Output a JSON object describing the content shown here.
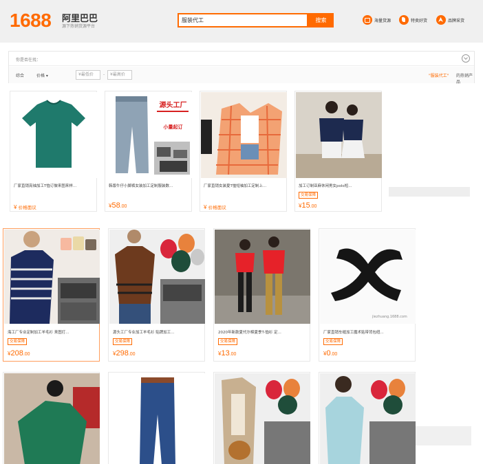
{
  "header": {
    "logo_number": "1688",
    "logo_name": "阿里巴巴",
    "logo_tagline": "源下热销货源平台",
    "search_value": "服装代工",
    "search_button": "搜索",
    "links": [
      {
        "label": "海量货源",
        "icon": "bulk-icon"
      },
      {
        "label": "特卖好货",
        "icon": "deal-icon"
      },
      {
        "label": "品牌采货",
        "icon": "brand-icon"
      }
    ]
  },
  "filter": {
    "guess_label": "你是否在找：",
    "sort_comprehensive": "综合",
    "sort_price": "价格 ▾",
    "price_min_placeholder": "¥最低价",
    "price_max_placeholder": "¥最高价",
    "price_dash": "-",
    "hot_query": "\"服装代工\"",
    "hot_suffix": "的热销产品"
  },
  "products": [
    {
      "title": "厂家直销亮袖加工T恤订做来图来样...",
      "price_label": "价格面议",
      "badge": "",
      "color_main": "#1f7a6c"
    },
    {
      "title": "韩版牛仔小脚裤女装加工定制服装数...",
      "price_int": "58",
      "price_dec": ".00",
      "badge": "",
      "banner": "源头工厂",
      "banner_sub": "小量起订"
    },
    {
      "title": "厂家直销女装夏T恤短袖加工定制上...",
      "price_label": "价格面议",
      "badge": ""
    },
    {
      "title": "加工订制亚麻休闲男女polo短...",
      "price_int": "15",
      "price_dec": ".00",
      "badge": "交易保障"
    },
    {
      "title": "海工厂专业定制加工羊毛衫 来图打...",
      "price_int": "208",
      "price_dec": ".00",
      "badge": "交易保障"
    },
    {
      "title": "源头工厂专业加工羊毛衫 贴牌加工...",
      "price_int": "298",
      "price_dec": ".00",
      "badge": "交易保障"
    },
    {
      "title": "2020年新款夏代尔棉夏季T-恤衫 定...",
      "price_int": "13",
      "price_dec": ".00",
      "badge": "交易保障"
    },
    {
      "title": "厂家直销车缝加工魔术贴带背包纽...",
      "price_int": "0",
      "price_dec": ".00",
      "badge": "交易保障",
      "watermark": "jiezhuang.1688.com"
    }
  ],
  "currency": "¥"
}
